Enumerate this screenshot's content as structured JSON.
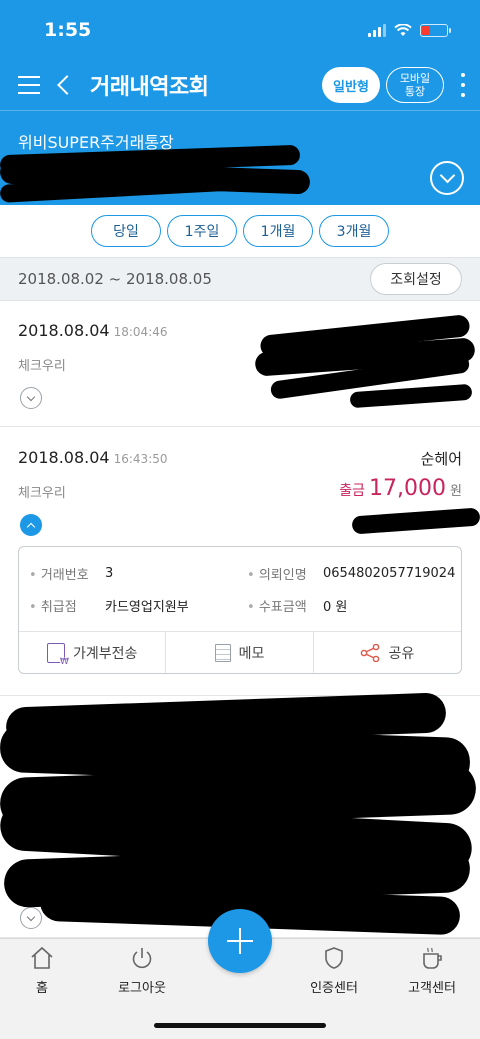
{
  "status_bar": {
    "time": "1:55"
  },
  "header": {
    "title": "거래내역조회",
    "mode_normal": "일반형",
    "mode_mobile": "모바일\n통장"
  },
  "account": {
    "name": "위비SUPER주거래통장"
  },
  "period_filters": [
    "당일",
    "1주일",
    "1개월",
    "3개월"
  ],
  "date_range": {
    "text": "2018.08.02 ~ 2018.08.05",
    "settings_label": "조회설정"
  },
  "transactions": [
    {
      "date": "2018.08.04",
      "time": "18:04:46",
      "type": "체크우리"
    },
    {
      "date": "2018.08.04",
      "time": "16:43:50",
      "type": "체크우리",
      "name": "순헤어",
      "amount_label": "출금",
      "amount": "17,000",
      "amount_unit": "원",
      "detail": {
        "txn_no_label": "거래번호",
        "txn_no": "3",
        "requester_label": "의뢰인명",
        "requester": "0654802057719024",
        "branch_label": "취급점",
        "branch": "카드영업지원부",
        "fee_label": "수표금액",
        "fee": "0 원"
      },
      "actions": [
        "가계부전송",
        "메모",
        "공유"
      ]
    }
  ],
  "bottom_nav": {
    "home": "홈",
    "logout": "로그아웃",
    "cert": "인증센터",
    "support": "고객센터"
  },
  "colors": {
    "primary": "#1c98e6",
    "withdraw": "#c8245e"
  }
}
